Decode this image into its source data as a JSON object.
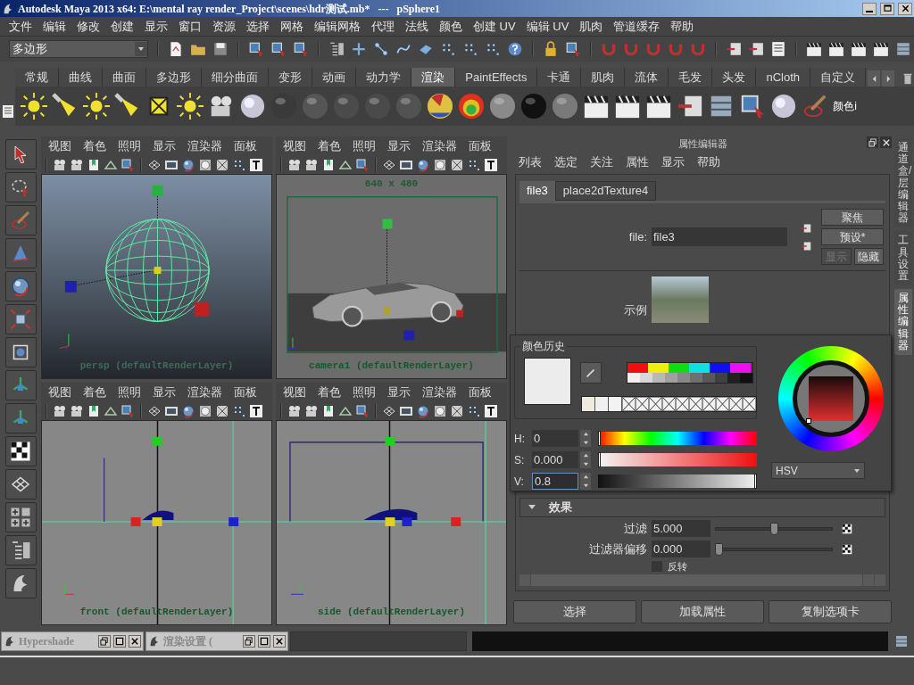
{
  "title_bar": {
    "title": "Autodesk Maya 2013 x64: E:\\mental ray render_Project\\scenes\\hdr测试.mb*   ---   pSphere1"
  },
  "menu_bar": [
    "文件",
    "编辑",
    "修改",
    "创建",
    "显示",
    "窗口",
    "资源",
    "选择",
    "网格",
    "编辑网格",
    "代理",
    "法线",
    "颜色",
    "创建 UV",
    "编辑 UV",
    "肌肉",
    "管道缓存",
    "帮助"
  ],
  "status_line": {
    "mode": "多边形"
  },
  "shelf": {
    "tabs": [
      {
        "label": "常规",
        "selected": false
      },
      {
        "label": "曲线",
        "selected": false
      },
      {
        "label": "曲面",
        "selected": false
      },
      {
        "label": "多边形",
        "selected": false
      },
      {
        "label": "细分曲面",
        "selected": false
      },
      {
        "label": "变形",
        "selected": false
      },
      {
        "label": "动画",
        "selected": false
      },
      {
        "label": "动力学",
        "selected": false
      },
      {
        "label": "渲染",
        "selected": true
      },
      {
        "label": "PaintEffects",
        "selected": false
      },
      {
        "label": "卡通",
        "selected": false
      },
      {
        "label": "肌肉",
        "selected": false
      },
      {
        "label": "流体",
        "selected": false
      },
      {
        "label": "毛发",
        "selected": false
      },
      {
        "label": "头发",
        "selected": false
      },
      {
        "label": "nCloth",
        "selected": false
      },
      {
        "label": "自定义",
        "selected": false
      }
    ],
    "last_item": "颜色i"
  },
  "viewports": [
    {
      "kind": "perspective",
      "menus": [
        "视图",
        "着色",
        "照明",
        "显示",
        "渲染器",
        "面板"
      ],
      "label": "persp (defaultRenderLayer)"
    },
    {
      "kind": "camera",
      "menus": [
        "视图",
        "着色",
        "照明",
        "显示",
        "渲染器",
        "面板"
      ],
      "resolution": "640 x 480",
      "label": "camera1 (defaultRenderLayer)"
    },
    {
      "kind": "front",
      "menus": [
        "视图",
        "着色",
        "照明",
        "显示",
        "渲染器",
        "面板"
      ],
      "label": "front (defaultRenderLayer)"
    },
    {
      "kind": "side",
      "menus": [
        "视图",
        "着色",
        "照明",
        "显示",
        "渲染器",
        "面板"
      ],
      "label": "side (defaultRenderLayer)"
    }
  ],
  "attribute_editor": {
    "title": "属性编辑器",
    "menus": [
      "列表",
      "选定",
      "关注",
      "属性",
      "显示",
      "帮助"
    ],
    "tabs": [
      {
        "label": "file3",
        "selected": true
      },
      {
        "label": "place2dTexture4",
        "selected": false
      }
    ],
    "file_label": "file:",
    "file_value": "file3",
    "buttons": [
      {
        "label": "聚焦",
        "disabled": false
      },
      {
        "label": "预设*",
        "disabled": false
      },
      {
        "label": "显示",
        "disabled": true
      },
      {
        "label": "隐藏",
        "disabled": false
      }
    ],
    "sample_label": "示例",
    "section": {
      "title": "效果",
      "expanded": true
    },
    "rows": [
      {
        "label": "过滤",
        "value": "5.000",
        "level": 0.5
      },
      {
        "label": "过滤器偏移",
        "value": "0.000",
        "level": 0
      }
    ],
    "checkbox": {
      "label": "反转",
      "checked": false
    },
    "bottom_buttons": [
      "选择",
      "加载属性",
      "复制选项卡"
    ]
  },
  "color_picker": {
    "history_title": "颜色历史",
    "palette": [
      {
        "color": "#ee1010"
      },
      {
        "color": "#eeee10"
      },
      {
        "color": "#10dd10"
      },
      {
        "color": "#10e0e0"
      },
      {
        "color": "#1010ee"
      },
      {
        "color": "#ee10ee"
      },
      {
        "color": "#f0f0f0"
      },
      {
        "color": "#d8d8d8"
      },
      {
        "color": "#b8b8b8"
      },
      {
        "color": "#a0a0a0"
      },
      {
        "color": "#888888"
      },
      {
        "color": "#707070"
      },
      {
        "color": "#585858"
      },
      {
        "color": "#404040"
      },
      {
        "color": "#202020"
      },
      {
        "color": "#101010"
      }
    ],
    "history": [
      {
        "kind": "color",
        "color": "#efeae0"
      },
      {
        "kind": "color",
        "color": "#f0f0f0"
      },
      {
        "kind": "color",
        "color": "#f2f2f2"
      },
      {
        "kind": "empty"
      },
      {
        "kind": "empty"
      },
      {
        "kind": "empty"
      },
      {
        "kind": "empty"
      },
      {
        "kind": "empty"
      },
      {
        "kind": "empty"
      },
      {
        "kind": "empty"
      },
      {
        "kind": "empty"
      },
      {
        "kind": "empty"
      },
      {
        "kind": "empty"
      }
    ],
    "channels": [
      {
        "kind": "hue",
        "label": "H:",
        "value": "0",
        "level": 0,
        "focused": false
      },
      {
        "kind": "saturation",
        "label": "S:",
        "value": "0.000",
        "level": 0,
        "focused": false
      },
      {
        "kind": "value",
        "label": "V:",
        "value": "0.8",
        "level": 1,
        "focused": true
      }
    ],
    "mode": "HSV"
  },
  "side_tabs": [
    {
      "label": "通道盒/层编辑器",
      "selected": false
    },
    {
      "label": "工具设置",
      "selected": false
    },
    {
      "label": "属性编辑器",
      "selected": true
    }
  ],
  "taskbar": [
    {
      "title": "Hypershade"
    },
    {
      "title": "渲染设置 ("
    }
  ]
}
